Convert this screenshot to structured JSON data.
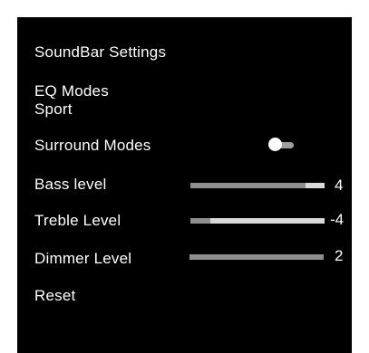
{
  "title": "SoundBar Settings",
  "eq": {
    "label": "EQ Modes",
    "value": "Sport"
  },
  "surround": {
    "label": "Surround Modes",
    "state": "off"
  },
  "bass": {
    "label": "Bass level",
    "value": "4",
    "fill_fraction": 0.86
  },
  "treble": {
    "label": "Treble Level",
    "value": "-4",
    "fill_fraction": 0.15
  },
  "dimmer": {
    "label": "Dimmer Level",
    "value": "2",
    "fill_fraction": 1.0
  },
  "reset": {
    "label": "Reset"
  },
  "colors": {
    "background": "#000000",
    "text": "#ffffff",
    "slider_track": "#d9d9d9",
    "slider_fill": "#8f8f8f"
  }
}
